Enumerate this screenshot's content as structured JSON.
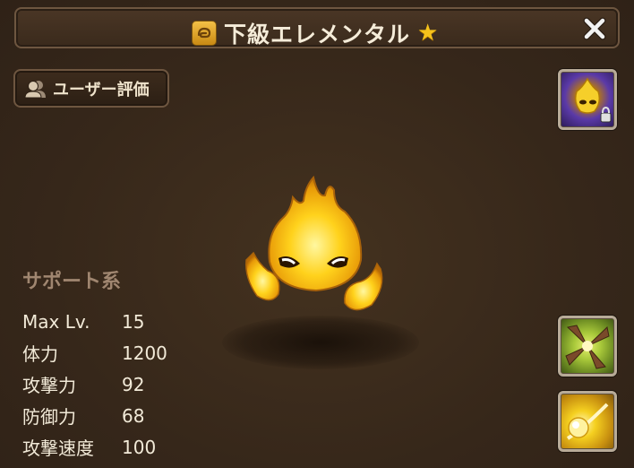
{
  "header": {
    "title": "下級エレメンタル",
    "star": "★"
  },
  "buttons": {
    "user_rating": "ユーザー評価",
    "close": "✕"
  },
  "monster": {
    "type_label": "サポート系"
  },
  "stats": [
    {
      "label": "Max Lv.",
      "value": "15"
    },
    {
      "label": "体力",
      "value": "1200"
    },
    {
      "label": "攻撃力",
      "value": "92"
    },
    {
      "label": "防御力",
      "value": "68"
    },
    {
      "label": "攻撃速度",
      "value": "100"
    }
  ],
  "icons": {
    "title": "monster-badge-icon",
    "rating": "users-icon",
    "skill1": "awakened-form-locked-icon",
    "skill2": "leaf-burst-skill-icon",
    "skill3": "light-orb-skill-icon"
  },
  "colors": {
    "background": "#3a2a1c",
    "frame": "#6e5640",
    "star": "#f5c21b",
    "text": "#f2ead8"
  }
}
